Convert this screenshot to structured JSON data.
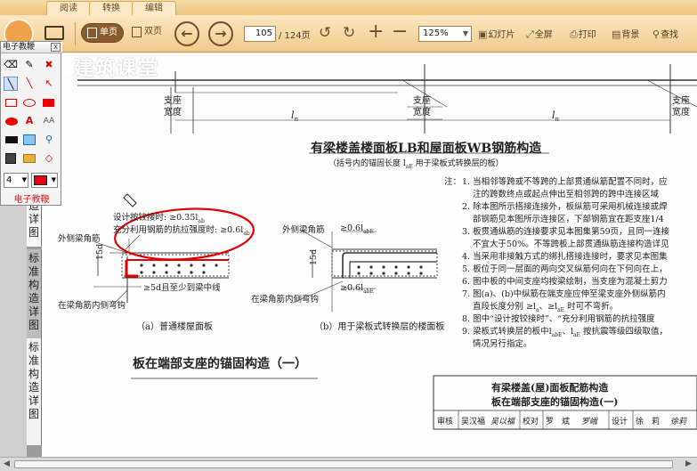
{
  "tabs": [
    "阅读",
    "转换",
    "编辑"
  ],
  "toolbar": {
    "single_page": "单页",
    "double_page": "双页",
    "current_page": "105",
    "page_total": "/ 124页",
    "zoom": "125%",
    "slideshow": "幻灯片",
    "fullscreen": "全屏",
    "print": "打印",
    "background": "背景",
    "search": "查找"
  },
  "watermark": "建筑课堂",
  "side_tabs": [
    "造详图",
    "标准构造详图",
    "标准构造详图"
  ],
  "panel": {
    "title": "电子教鞭",
    "close": "X",
    "line_width": "4",
    "footer": "电子教鞭",
    "color": "#e60012"
  },
  "drawing": {
    "support_label_1": "支座",
    "support_label_2": "宽度",
    "span_label": "l",
    "span_sub": "n",
    "main_title": "有梁楼盖楼面板LB和屋面板WB钢筋构造",
    "subtitle": "（括号内的锚固长度 l",
    "subtitle_sub": "aE",
    "subtitle_end": " 用于梁板式转换层的板）",
    "annot_1": "设计按铰接时: ≥0.35l",
    "annot_1_sub": "ab",
    "annot_2": "充分利用钢筋的抗拉强度时: ≥0.6l",
    "annot_2_sub": "ab",
    "left_top_label": "外侧梁角筋",
    "anchor_15d": "15d",
    "anchor_5d": "≥5d且至少到梁中线",
    "inner_label": "在梁角筋内侧弯钩",
    "caption_a": "（a）普通楼屋面板",
    "right_top_label": "外侧梁角筋",
    "right_dim": "≥0.6l",
    "right_dim_sub": "abE",
    "right_dim_2": "≥0.6l",
    "right_dim_2_sub": "abE",
    "right_inner": "在梁角筋内侧弯钩",
    "caption_b": "（b）用于梁板式转换层的楼面板",
    "section_title": "板在端部支座的锚固构造（一）",
    "notes_label": "注：",
    "notes": [
      "1. 当相邻等跨或不等跨的上部贯通纵筋配置不同时，应",
      "注的跨数终点或起点伸出至相邻跨的跨中连接区域",
      "2. 除本图所示搭接连接外，板纵筋可采用机械连接或焊",
      "部钢筋见本图所示连接区，下部钢筋宜在距支座1/4",
      "3. 板贯通纵筋的连接要求见本图集第59页，且同一连接",
      "不宜大于50%。不等跨板上部贯通纵筋连接构造详见",
      "4. 当采用非接触方式的绑扎搭接连接时，要求见本图集",
      "5. 板位于同一层面的两向交叉纵筋何向在下何向在上，",
      "6. 图中板的中间支座均按梁绘制，当支座为混凝土剪力",
      "7. 图(a)、(b)中纵筋在端支座应伸至梁支座外侧纵筋内",
      "直段长度分别 ≥l",
      "8. 图中“设计按铰接时”、“充分利用钢筋的抗拉强度",
      "9. 梁板式转换层的板中l",
      "情况另行指定。"
    ],
    "note_7b_mid": "a",
    "note_7b_rest": "、≥l",
    "note_7b_sub2": "aE",
    "note_7b_end": " 时可不弯折。",
    "note_9_sub": "abE",
    "note_9_mid": "、l",
    "note_9_sub2": "aE",
    "note_9_end": " 按抗震等级四级取值，",
    "titleblock_1": "有梁楼盖(屋)面板配筋构造",
    "titleblock_2": "板在端部支座的锚固构造(一)",
    "sign_row": [
      "审核",
      "吴汉福",
      "吴以福",
      "校对",
      "罗　斌",
      "罗峨",
      "设计",
      "徐　莉",
      "徐莉"
    ]
  }
}
